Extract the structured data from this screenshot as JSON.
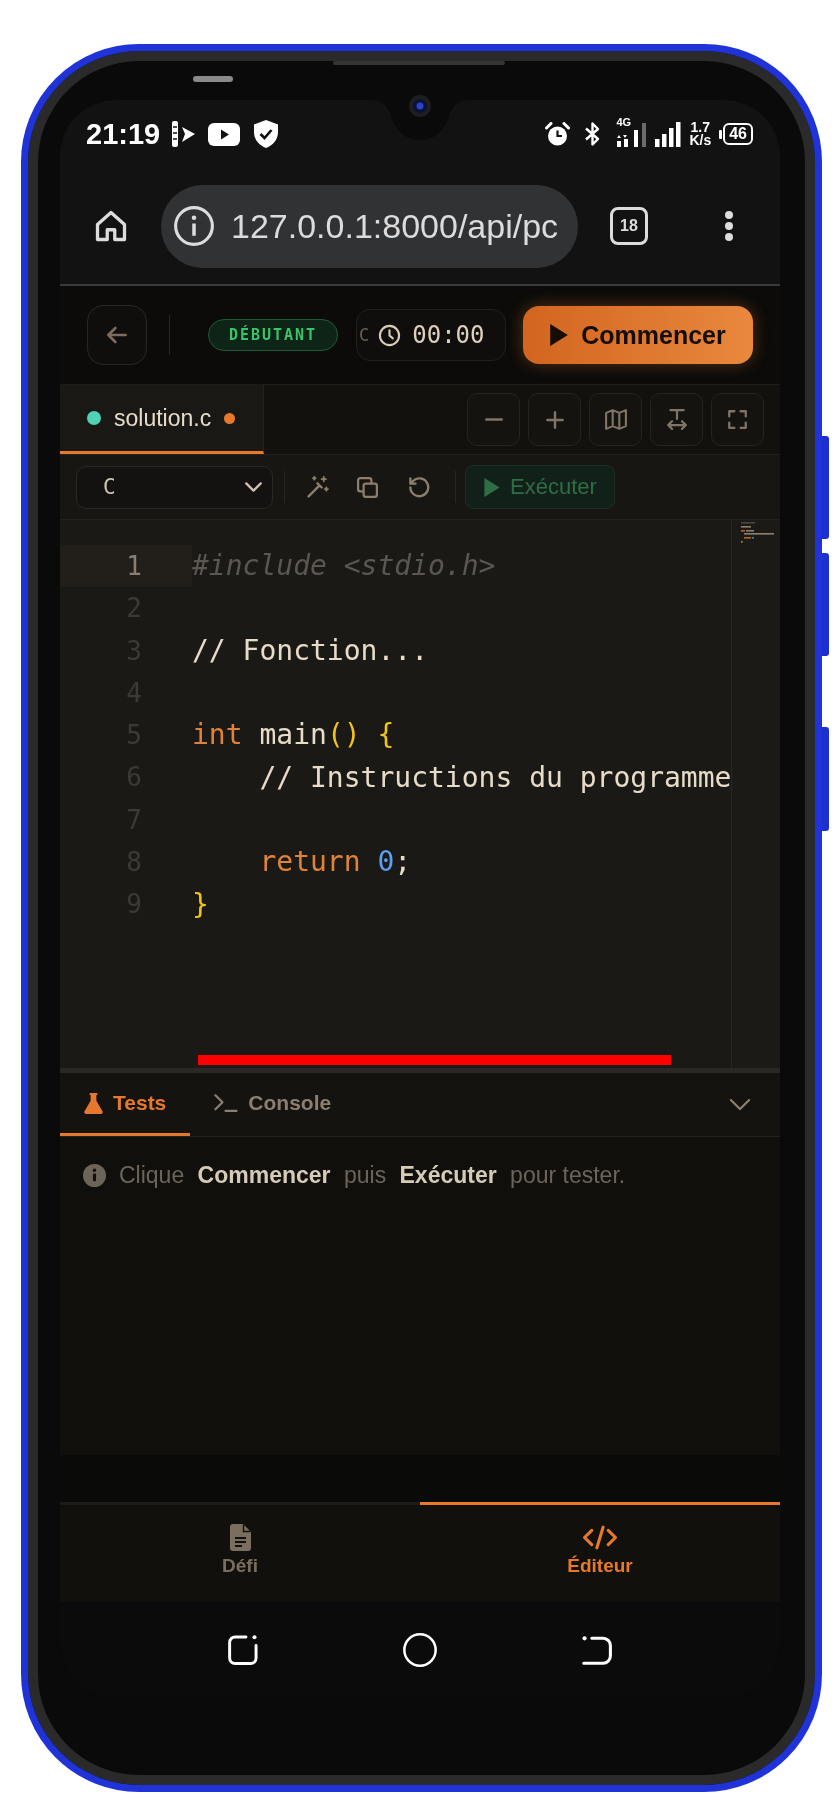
{
  "status_bar": {
    "time": "21:19",
    "network_type": "4G",
    "network_speed": "1.7",
    "network_speed_unit": "K/s",
    "battery": "46"
  },
  "browser": {
    "url": "127.0.0.1:8000/api/pc",
    "tab_count": "18"
  },
  "header": {
    "level_badge": "DÉBUTANT",
    "timer_prefix": "C",
    "timer": "00:00",
    "start_button": "Commencer"
  },
  "editor_tabs": [
    {
      "label": "solution.c",
      "selected": true,
      "modified": true
    }
  ],
  "editor_toolbar": {
    "language": "C",
    "run_button": {
      "label": "Exécuter",
      "disabled": true
    }
  },
  "code": {
    "lines": [
      {
        "number": "1",
        "current": true,
        "indented": false,
        "tokens": [
          {
            "kind": "directive",
            "text": "#include <stdio.h>"
          }
        ]
      },
      {
        "number": "2",
        "current": false
      },
      {
        "number": "3",
        "current": false,
        "indented": false,
        "tokens": [
          {
            "kind": "comment",
            "text": "// Fonction..."
          }
        ]
      },
      {
        "number": "4",
        "current": false
      },
      {
        "number": "5",
        "current": false,
        "indented": false,
        "tokens": [
          {
            "kind": "keyword",
            "text": "int"
          },
          {
            "kind": "plain",
            "text": " main"
          },
          {
            "kind": "bracket",
            "text": "()"
          },
          {
            "kind": "bracket",
            "text": " {"
          }
        ]
      },
      {
        "number": "6",
        "current": false,
        "indented": true,
        "tokens": [
          {
            "kind": "comment",
            "text": "// Instructions du programme"
          }
        ]
      },
      {
        "number": "7",
        "current": false
      },
      {
        "number": "8",
        "current": false,
        "indented": true,
        "tokens": [
          {
            "kind": "keyword",
            "text": "return"
          },
          {
            "kind": "number",
            "text": " 0"
          },
          {
            "kind": "plain",
            "text": ";"
          }
        ]
      },
      {
        "number": "9",
        "current": false,
        "indented": false,
        "tokens": [
          {
            "kind": "bracket",
            "text": "}"
          }
        ]
      }
    ]
  },
  "panel": {
    "tabs": [
      {
        "kind": "tests",
        "label": "Tests",
        "selected": true
      },
      {
        "kind": "console",
        "label": "Console",
        "selected": false
      }
    ],
    "message": "Clique **Commencer** puis **Exécuter** pour tester."
  },
  "bottom_nav": [
    {
      "kind": "challenge",
      "label": "Défi",
      "selected": false
    },
    {
      "kind": "editor",
      "label": "Éditeur",
      "selected": true
    }
  ]
}
